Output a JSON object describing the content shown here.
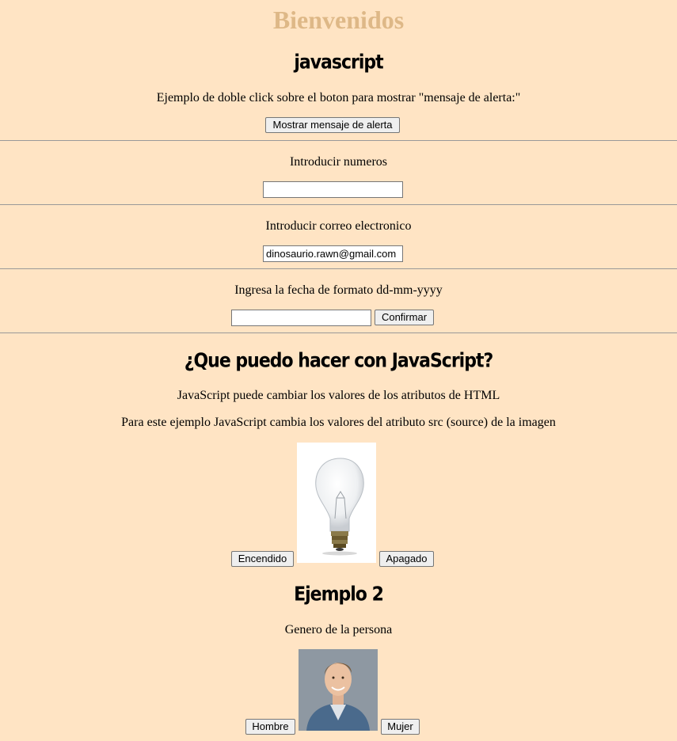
{
  "header": {
    "title": "Bienvenidos"
  },
  "section_js": {
    "heading": "javascript",
    "description": "Ejemplo de doble click sobre el boton para mostrar \"mensaje de alerta:\"",
    "alert_button": "Mostrar mensaje de alerta"
  },
  "numbers": {
    "label": "Introducir numeros",
    "value": ""
  },
  "email": {
    "label": "Introducir correo electronico",
    "value": "dinosaurio.rawn@gmail.com"
  },
  "date": {
    "label": "Ingresa la fecha de formato dd-mm-yyyy",
    "value": "",
    "confirm_button": "Confirmar"
  },
  "section_what": {
    "heading": "¿Que puedo hacer con JavaScript?",
    "line1": "JavaScript puede cambiar los valores de los atributos de HTML",
    "line2": "Para este ejemplo JavaScript cambia los valores del atributo src (source) de la imagen",
    "on_button": "Encendido",
    "off_button": "Apagado"
  },
  "example2": {
    "heading": "Ejemplo 2",
    "label": "Genero de la persona",
    "male_button": "Hombre",
    "female_button": "Mujer"
  }
}
